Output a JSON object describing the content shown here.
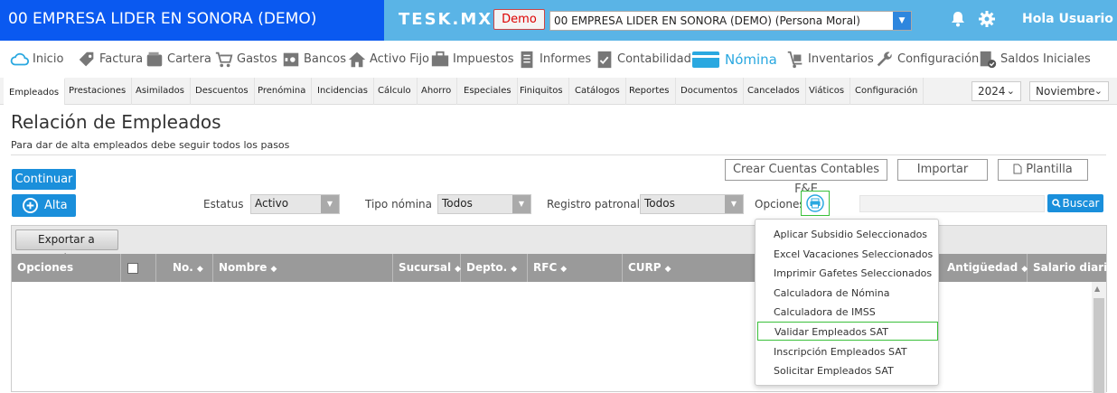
{
  "header": {
    "company": "00 EMPRESA LIDER EN SONORA (DEMO)",
    "brand": "TESK.MX",
    "demo_label": "Demo",
    "company_select": "00 EMPRESA LIDER EN SONORA (DEMO) (Persona Moral)",
    "greeting": "Hola Usuario"
  },
  "modules": [
    {
      "label": "Inicio",
      "icon": "cloud-icon"
    },
    {
      "label": "Factura",
      "icon": "tag-icon"
    },
    {
      "label": "Cartera",
      "icon": "wallet-icon"
    },
    {
      "label": "Gastos",
      "icon": "cart-icon"
    },
    {
      "label": "Bancos",
      "icon": "safe-icon"
    },
    {
      "label": "Activo Fijo",
      "icon": "house-icon"
    },
    {
      "label": "Impuestos",
      "icon": "briefcase-icon"
    },
    {
      "label": "Informes",
      "icon": "document-icon"
    },
    {
      "label": "Contabilidad",
      "icon": "ledger-icon"
    },
    {
      "label": "Nómina",
      "icon": "card-icon"
    },
    {
      "label": "Inventarios",
      "icon": "dolly-icon"
    },
    {
      "label": "Configuración",
      "icon": "wrench-icon"
    },
    {
      "label": "Saldos Iniciales",
      "icon": "checklist-icon"
    }
  ],
  "tabs": [
    "Empleados",
    "Prestaciones",
    "Asimilados",
    "Descuentos",
    "Prenómina",
    "Incidencias",
    "Cálculo",
    "Ahorro",
    "Especiales",
    "Finiquitos",
    "Catálogos",
    "Reportes",
    "Documentos",
    "Cancelados",
    "Viáticos",
    "Configuración"
  ],
  "period": {
    "year": "2024",
    "month": "Noviembre"
  },
  "page": {
    "title": "Relación de Empleados",
    "subtitle": "Para dar de alta empleados debe seguir todos los pasos"
  },
  "actions": {
    "continuar": "Continuar",
    "alta": "Alta",
    "crear_cuentas": "Crear Cuentas Contables F&E",
    "importar": "Importar",
    "plantilla": "Plantilla",
    "exportar": "Exportar a Excel",
    "buscar": "Buscar"
  },
  "filters": {
    "estatus_label": "Estatus",
    "estatus_value": "Activo",
    "tipo_label": "Tipo nómina",
    "tipo_value": "Todos",
    "registro_label": "Registro patronal",
    "registro_value": "Todos",
    "opciones_label": "Opciones",
    "search_value": ""
  },
  "grid": {
    "columns": [
      "Opciones",
      "No.",
      "Nombre",
      "Sucursal",
      "Depto.",
      "RFC",
      "CURP",
      "Antigüedad",
      "Salario diario"
    ]
  },
  "options_menu": [
    "Aplicar Subsidio Seleccionados",
    "Excel Vacaciones Seleccionados",
    "Imprimir Gafetes Seleccionados",
    "Calculadora de Nómina",
    "Calculadora de IMSS",
    "Validar Empleados SAT",
    "Inscripción Empleados SAT",
    "Solicitar Empleados SAT"
  ],
  "colors": {
    "company_bar": "#0a59f0",
    "top_bar": "#5ab4e6",
    "accent": "#1a8fdb",
    "highlight": "#3ac03a"
  }
}
